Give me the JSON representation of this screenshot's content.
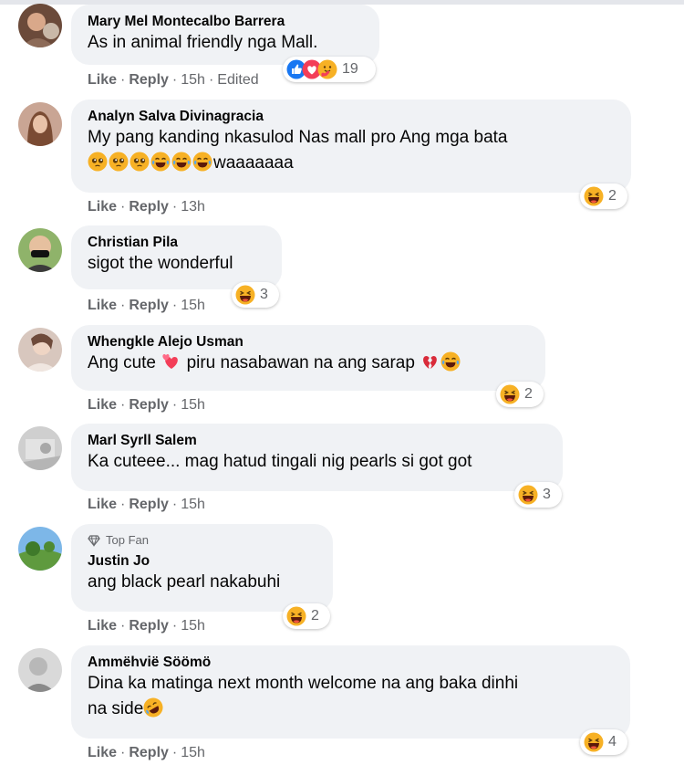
{
  "comments": [
    {
      "author": "Mary Mel Montecalbo Barrera",
      "text": "As in animal friendly nga Mall.",
      "actions": {
        "like": "Like",
        "reply": "Reply",
        "time": "15h",
        "edited": "Edited"
      },
      "reactions": {
        "icons": [
          "like-icon",
          "love-icon",
          "care-icon"
        ],
        "count": "19"
      }
    },
    {
      "author": "Analyn Salva Divinagracia",
      "text_line1": "My pang kanding nkasulod Nas mall pro Ang mga bata",
      "text_line2_emojis": [
        "pleading-face",
        "pleading-face",
        "pleading-face",
        "tears-of-joy",
        "tears-of-joy",
        "tears-of-joy"
      ],
      "text_line2": "waaaaaaa",
      "actions": {
        "like": "Like",
        "reply": "Reply",
        "time": "13h"
      },
      "reactions": {
        "icons": [
          "haha-icon"
        ],
        "count": "2"
      }
    },
    {
      "author": "Christian Pila",
      "text": "sigot the wonderful",
      "actions": {
        "like": "Like",
        "reply": "Reply",
        "time": "15h"
      },
      "reactions": {
        "icons": [
          "haha-icon"
        ],
        "count": "3"
      }
    },
    {
      "author": "Whengkle Alejo Usman",
      "text_a": "Ang cute",
      "text_b": "piru nasabawan na ang sarap",
      "text_emojis": [
        "two-hearts",
        "broken-heart",
        "tears-of-joy"
      ],
      "actions": {
        "like": "Like",
        "reply": "Reply",
        "time": "15h"
      },
      "reactions": {
        "icons": [
          "haha-icon"
        ],
        "count": "2"
      }
    },
    {
      "author": "Marl Syrll Salem",
      "text": "Ka cuteee... mag hatud tingali nig pearls si got got",
      "actions": {
        "like": "Like",
        "reply": "Reply",
        "time": "15h"
      },
      "reactions": {
        "icons": [
          "haha-icon"
        ],
        "count": "3"
      }
    },
    {
      "badge": "Top Fan",
      "author": "Justin Jo",
      "text": "ang black pearl nakabuhi",
      "actions": {
        "like": "Like",
        "reply": "Reply",
        "time": "15h"
      },
      "reactions": {
        "icons": [
          "haha-icon"
        ],
        "count": "2"
      }
    },
    {
      "author": "Ammëhvië Söömö",
      "text_line1": "Dina ka matinga next month welcome na ang baka dinhi",
      "text_line2": "na side",
      "text_emojis": [
        "rofl-face"
      ],
      "actions": {
        "like": "Like",
        "reply": "Reply",
        "time": "15h"
      },
      "reactions": {
        "icons": [
          "haha-icon"
        ],
        "count": "4"
      }
    }
  ],
  "separator": "·",
  "colors": {
    "bubble": "#f0f2f5",
    "meta": "#65676b",
    "text": "#050505",
    "like_blue": "#1877f2",
    "love_red": "#f33e58",
    "haha_yellow": "#f7b125"
  }
}
